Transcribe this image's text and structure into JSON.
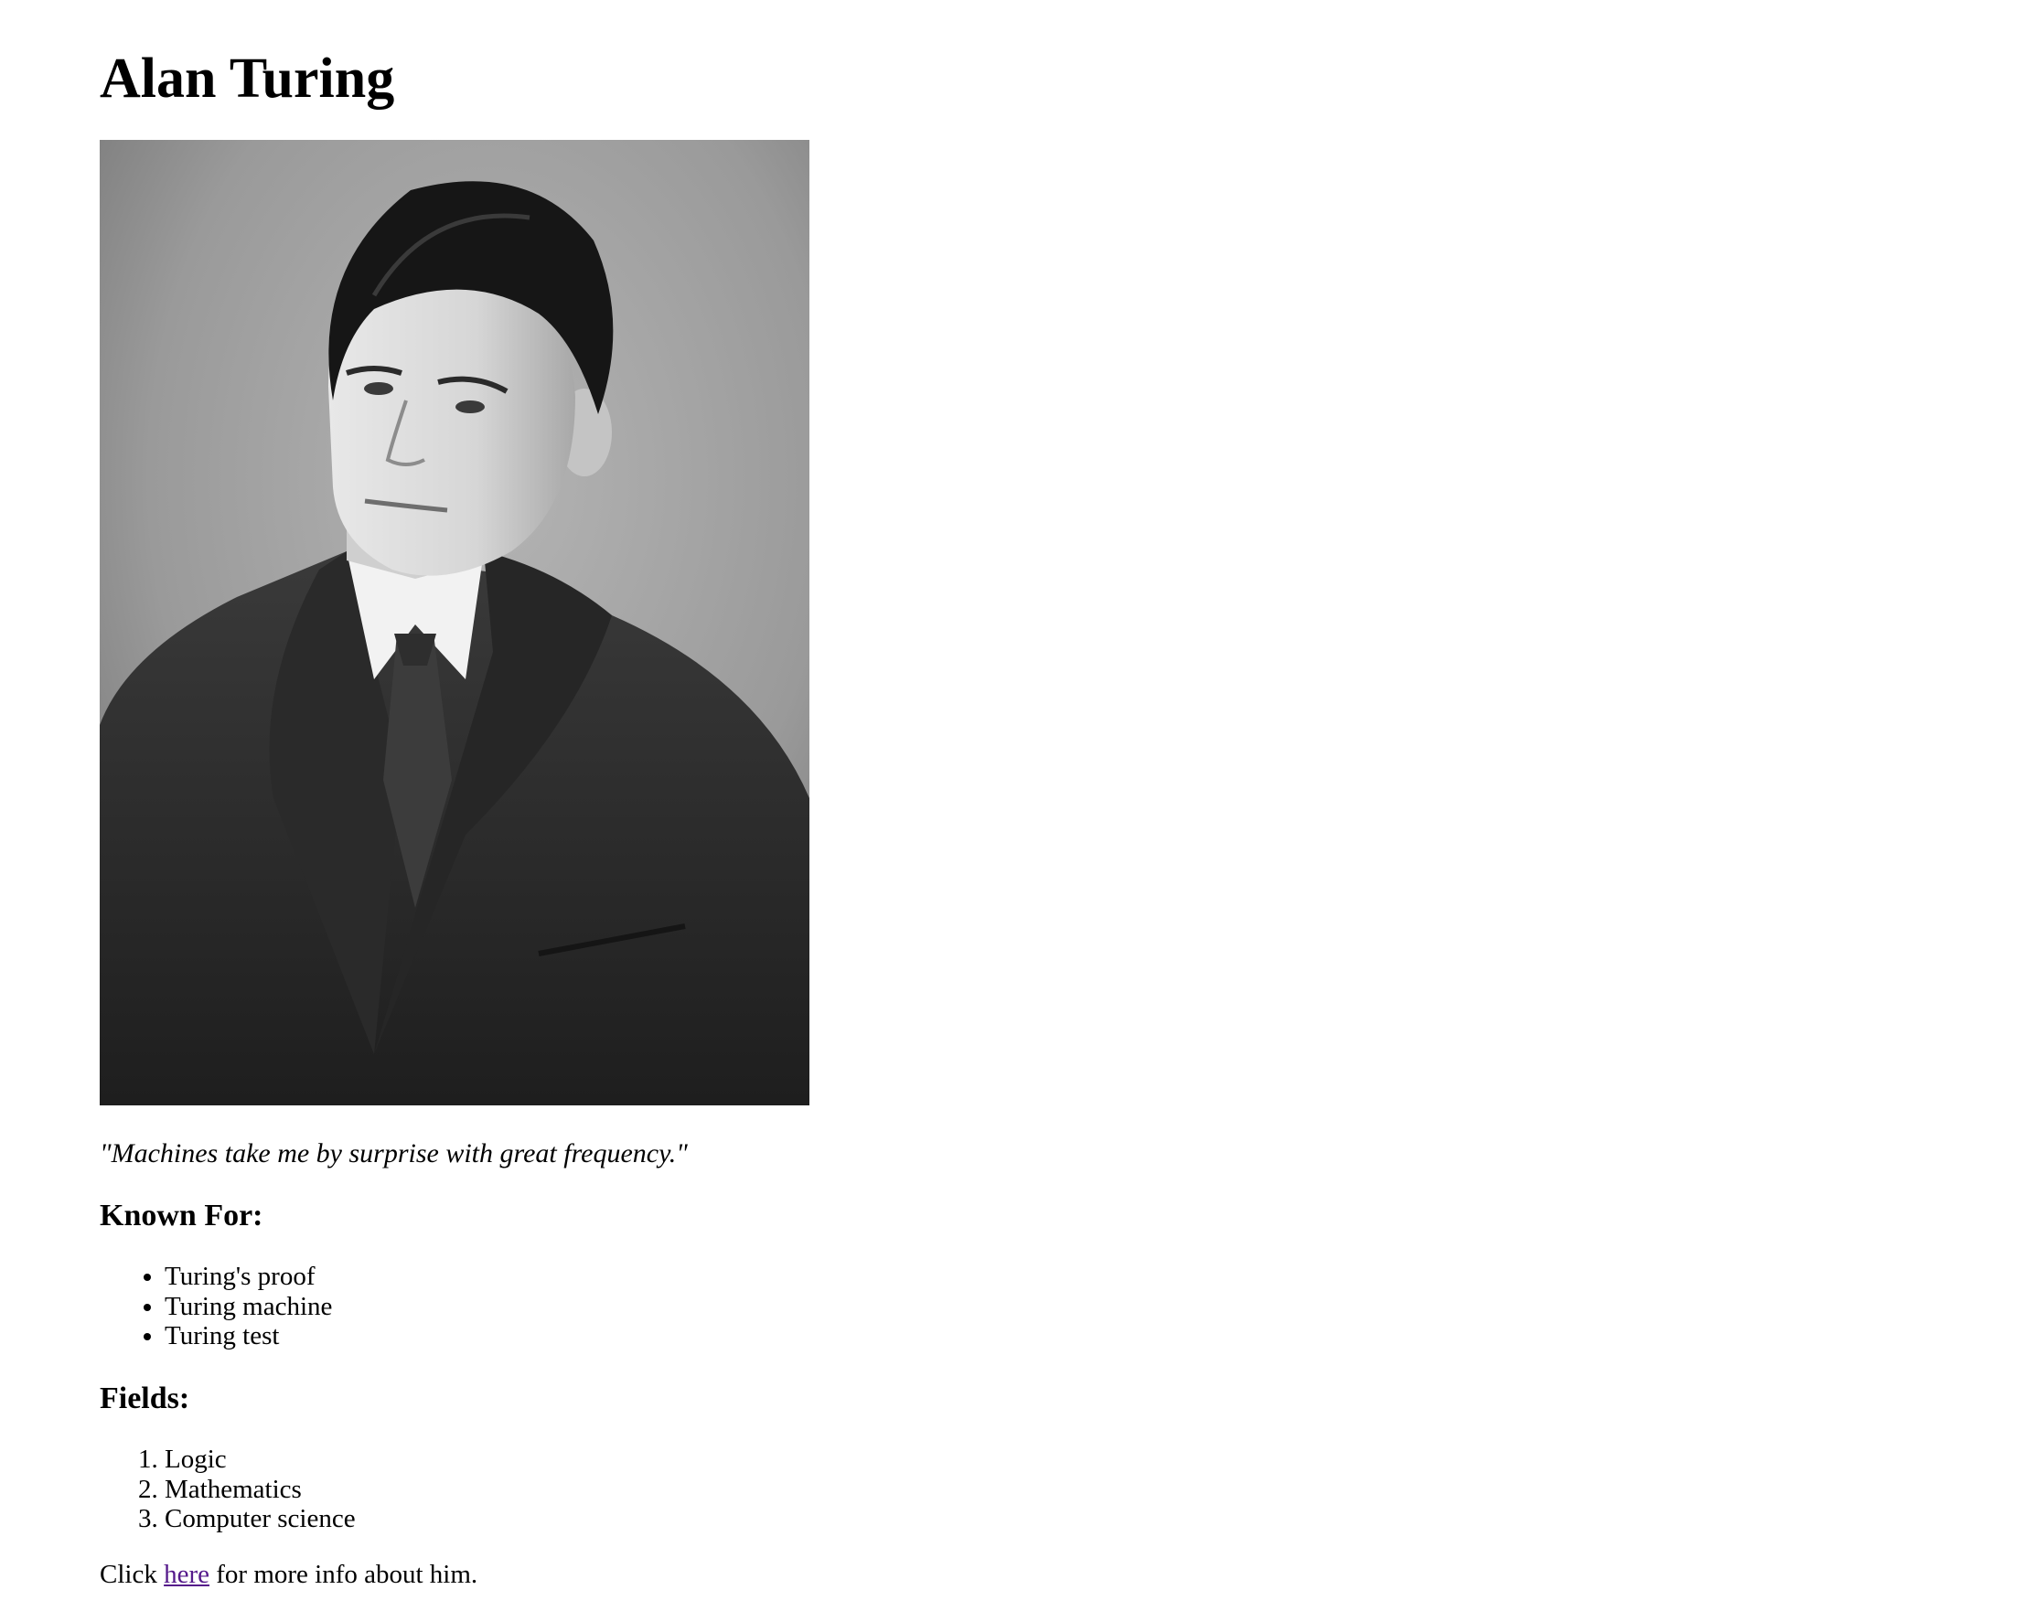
{
  "page": {
    "title": "Alan Turing",
    "quote": "\"Machines take me by surprise with great frequency.\"",
    "known_for": {
      "heading": "Known For:",
      "items": [
        "Turing's proof",
        "Turing machine",
        "Turing test"
      ]
    },
    "fields": {
      "heading": "Fields:",
      "items": [
        "Logic",
        "Mathematics",
        "Computer science"
      ]
    },
    "more_info": {
      "prefix": "Click ",
      "link_text": "here",
      "suffix": " for more info about him."
    }
  },
  "colors": {
    "text": "#000000",
    "background": "#ffffff",
    "visited_link": "#551a8b"
  }
}
